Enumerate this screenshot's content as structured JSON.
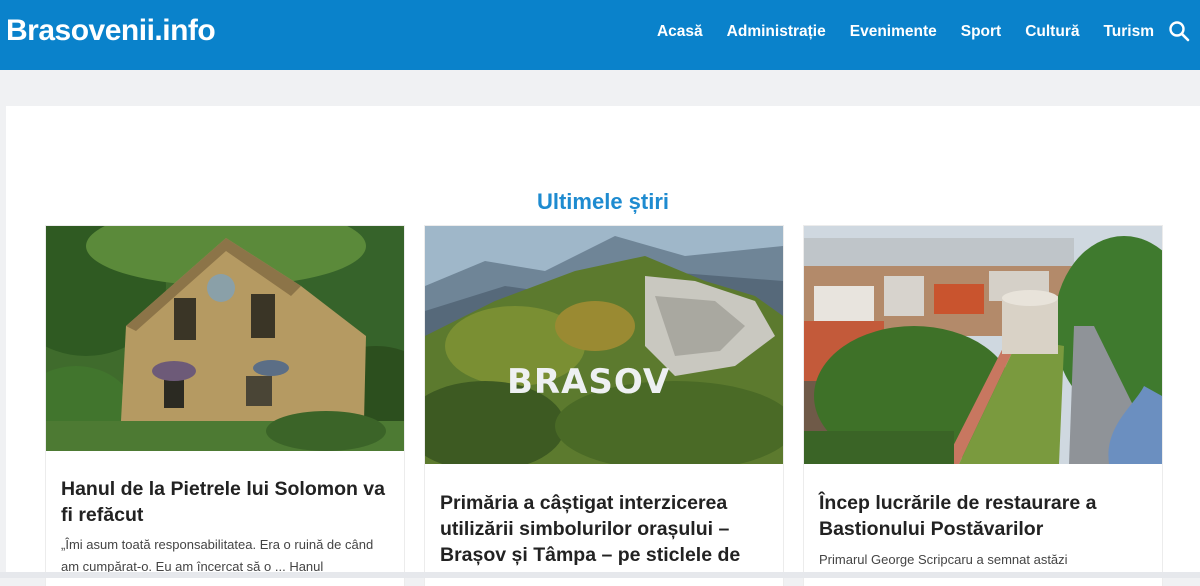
{
  "header": {
    "logo": "Brasovenii.info",
    "nav": [
      {
        "label": "Acasă"
      },
      {
        "label": "Administrație"
      },
      {
        "label": "Evenimente"
      },
      {
        "label": "Sport"
      },
      {
        "label": "Cultură"
      },
      {
        "label": "Turism"
      }
    ],
    "search_icon": "search-icon"
  },
  "main": {
    "section_title": "Ultimele știri",
    "cards": [
      {
        "title": "Hanul de la Pietrele lui Solomon va fi refăcut",
        "excerpt": "„Îmi asum toată responsabilitatea. Era o ruină de când am cumpărat-o. Eu am încercat să o ... Hanul"
      },
      {
        "title": "Primăria a câștigat interzicerea utilizării simbolurilor orașului – Brașov și Tâmpa – pe sticlele de",
        "image_sign": "BRASOV"
      },
      {
        "title": "Încep lucrările de restaurare a Bastionului Postăvarilor",
        "excerpt": "Primarul George Scripcaru a semnat astăzi"
      }
    ]
  },
  "colors": {
    "header_bg": "#0a82cb",
    "section_title": "#1e8bd0",
    "page_bg": "#f0f1f3"
  }
}
